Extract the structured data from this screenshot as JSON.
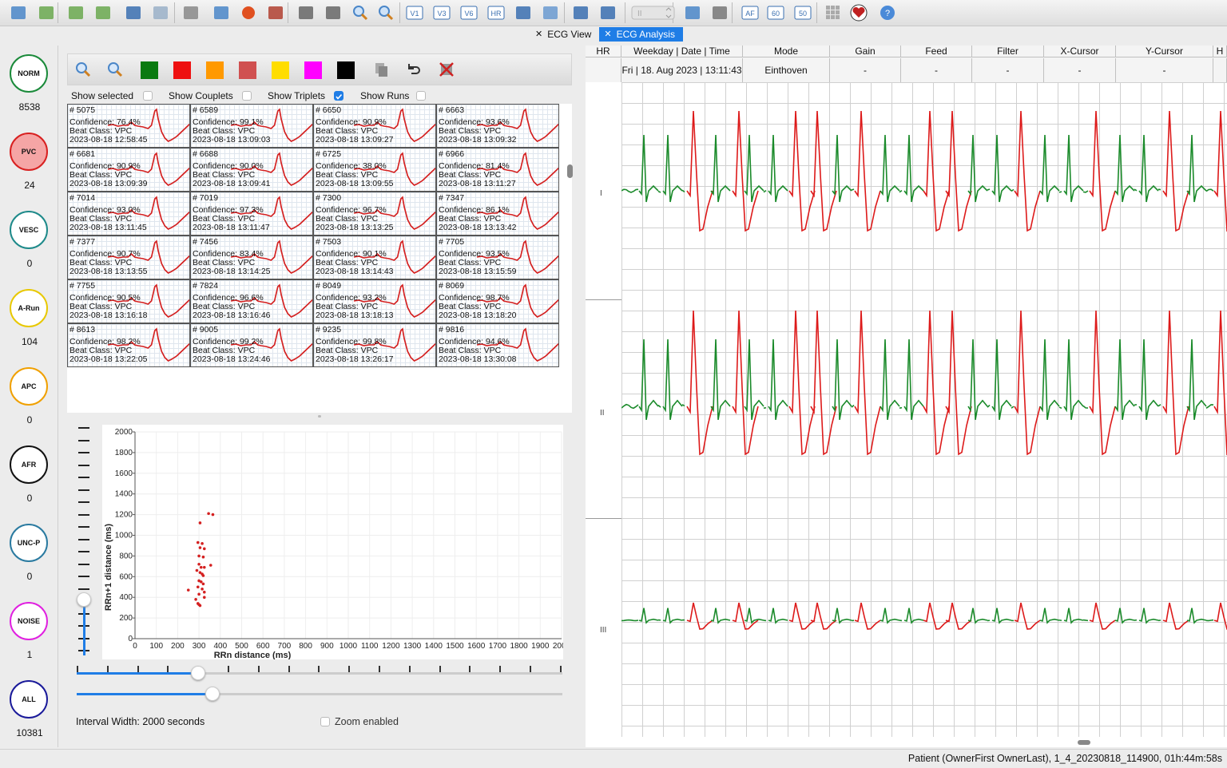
{
  "tabs": [
    {
      "label": "ECG View",
      "active": false
    },
    {
      "label": "ECG Analysis",
      "active": true
    }
  ],
  "toolbar": {
    "icons": [
      "open-file-icon",
      "folder-icon",
      "import-down-icon",
      "export-icon",
      "save-icon",
      "save-as-icon",
      "print-icon",
      "monitor-icon",
      "record-icon",
      "tools-icon",
      "script-icon",
      "script-edit-icon",
      "zoom-out-icon",
      "zoom-in-icon",
      "lead-v1-icon",
      "lead-v3-icon",
      "lead-v6-icon",
      "hr-icon",
      "noise-icon",
      "trend-icon",
      "report-icon",
      "analysis-chart-icon",
      "channel-select-icon",
      "database-icon",
      "lock-icon",
      "af-icon",
      "speed-60-icon",
      "speed-50-icon",
      "grid-icon",
      "heart-icon",
      "help-icon"
    ],
    "labels": {
      "v1": "V1",
      "v3": "V3",
      "v6": "V6",
      "hr": "HR",
      "af": "AF",
      "s60": "60",
      "s50": "50",
      "sel": "II"
    }
  },
  "classes": [
    {
      "name": "NORM",
      "count": "8538",
      "color": "#1a8a3a",
      "fill": "#ffffff"
    },
    {
      "name": "PVC",
      "count": "24",
      "color": "#d82020",
      "fill": "#f5a5a5"
    },
    {
      "name": "VESC",
      "count": "0",
      "color": "#1e8a8a",
      "fill": "#ffffff"
    },
    {
      "name": "A-Run",
      "count": "104",
      "color": "#e8c800",
      "fill": "#ffffff"
    },
    {
      "name": "APC",
      "count": "0",
      "color": "#f0a000",
      "fill": "#ffffff"
    },
    {
      "name": "AFR",
      "count": "0",
      "color": "#111111",
      "fill": "#ffffff"
    },
    {
      "name": "UNC-P",
      "count": "0",
      "color": "#2a7aa0",
      "fill": "#ffffff"
    },
    {
      "name": "NOISE",
      "count": "1",
      "color": "#e020e0",
      "fill": "#ffffff"
    },
    {
      "name": "ALL",
      "count": "10381",
      "color": "#1a1a9a",
      "fill": "#ffffff"
    }
  ],
  "filter_bar": {
    "swatches": [
      "#0a7a10",
      "#ee1010",
      "#ff9900",
      "#d05050",
      "#ffdd00",
      "#ff00ff",
      "#000000"
    ]
  },
  "filters": {
    "selected": "Show selected",
    "couplets": "Show Couplets",
    "triplets": "Show Triplets",
    "runs": "Show Runs",
    "triplets_checked": true
  },
  "beats": [
    {
      "id": "# 5075",
      "conf": "Confidence: 76.4%",
      "cls": "Beat Class: VPC",
      "time": "2023-08-18 12:58:45"
    },
    {
      "id": "# 6589",
      "conf": "Confidence: 99.1%",
      "cls": "Beat Class: VPC",
      "time": "2023-08-18 13:09:03"
    },
    {
      "id": "# 6650",
      "conf": "Confidence: 90.9%",
      "cls": "Beat Class: VPC",
      "time": "2023-08-18 13:09:27"
    },
    {
      "id": "# 6663",
      "conf": "Confidence: 93.6%",
      "cls": "Beat Class: VPC",
      "time": "2023-08-18 13:09:32"
    },
    {
      "id": "# 6681",
      "conf": "Confidence: 90.9%",
      "cls": "Beat Class: VPC",
      "time": "2023-08-18 13:09:39"
    },
    {
      "id": "# 6688",
      "conf": "Confidence: 90.0%",
      "cls": "Beat Class: VPC",
      "time": "2023-08-18 13:09:41"
    },
    {
      "id": "# 6725",
      "conf": "Confidence: 38.0%",
      "cls": "Beat Class: VPC",
      "time": "2023-08-18 13:09:55"
    },
    {
      "id": "# 6966",
      "conf": "Confidence: 81.4%",
      "cls": "Beat Class: VPC",
      "time": "2023-08-18 13:11:27"
    },
    {
      "id": "# 7014",
      "conf": "Confidence: 93.0%",
      "cls": "Beat Class: VPC",
      "time": "2023-08-18 13:11:45"
    },
    {
      "id": "# 7019",
      "conf": "Confidence: 97.3%",
      "cls": "Beat Class: VPC",
      "time": "2023-08-18 13:11:47"
    },
    {
      "id": "# 7300",
      "conf": "Confidence: 96.7%",
      "cls": "Beat Class: VPC",
      "time": "2023-08-18 13:13:25"
    },
    {
      "id": "# 7347",
      "conf": "Confidence: 86.1%",
      "cls": "Beat Class: VPC",
      "time": "2023-08-18 13:13:42"
    },
    {
      "id": "# 7377",
      "conf": "Confidence: 90.7%",
      "cls": "Beat Class: VPC",
      "time": "2023-08-18 13:13:55"
    },
    {
      "id": "# 7456",
      "conf": "Confidence: 83.4%",
      "cls": "Beat Class: VPC",
      "time": "2023-08-18 13:14:25"
    },
    {
      "id": "# 7503",
      "conf": "Confidence: 90.1%",
      "cls": "Beat Class: VPC",
      "time": "2023-08-18 13:14:43"
    },
    {
      "id": "# 7705",
      "conf": "Confidence: 93.5%",
      "cls": "Beat Class: VPC",
      "time": "2023-08-18 13:15:59"
    },
    {
      "id": "# 7755",
      "conf": "Confidence: 90.5%",
      "cls": "Beat Class: VPC",
      "time": "2023-08-18 13:16:18"
    },
    {
      "id": "# 7824",
      "conf": "Confidence: 96.6%",
      "cls": "Beat Class: VPC",
      "time": "2023-08-18 13:16:46"
    },
    {
      "id": "# 8049",
      "conf": "Confidence: 93.2%",
      "cls": "Beat Class: VPC",
      "time": "2023-08-18 13:18:13"
    },
    {
      "id": "# 8069",
      "conf": "Confidence: 98.7%",
      "cls": "Beat Class: VPC",
      "time": "2023-08-18 13:18:20"
    },
    {
      "id": "# 8613",
      "conf": "Confidence: 98.2%",
      "cls": "Beat Class: VPC",
      "time": "2023-08-18 13:22:05"
    },
    {
      "id": "# 9005",
      "conf": "Confidence: 99.2%",
      "cls": "Beat Class: VPC",
      "time": "2023-08-18 13:24:46"
    },
    {
      "id": "# 9235",
      "conf": "Confidence: 99.8%",
      "cls": "Beat Class: VPC",
      "time": "2023-08-18 13:26:17"
    },
    {
      "id": "# 9816",
      "conf": "Confidence: 94.6%",
      "cls": "Beat Class: VPC",
      "time": "2023-08-18 13:30:08"
    }
  ],
  "chart_data": {
    "type": "scatter",
    "xlabel": "RRn distance (ms)",
    "ylabel": "RRn+1 distance (ms)",
    "xlim": [
      0,
      2000
    ],
    "ylim": [
      0,
      2000
    ],
    "xticks": [
      0,
      100,
      200,
      300,
      400,
      500,
      600,
      700,
      800,
      900,
      1000,
      1100,
      1200,
      1300,
      1400,
      1500,
      1600,
      1700,
      1800,
      1900,
      2000
    ],
    "yticks": [
      0,
      200,
      400,
      600,
      800,
      1000,
      1200,
      1400,
      1600,
      1800,
      2000
    ],
    "grid": true,
    "point_color": "#d42020",
    "points": [
      [
        345,
        1210
      ],
      [
        365,
        1200
      ],
      [
        305,
        1120
      ],
      [
        295,
        930
      ],
      [
        315,
        920
      ],
      [
        305,
        880
      ],
      [
        325,
        870
      ],
      [
        300,
        800
      ],
      [
        320,
        790
      ],
      [
        300,
        720
      ],
      [
        355,
        710
      ],
      [
        310,
        690
      ],
      [
        325,
        690
      ],
      [
        290,
        660
      ],
      [
        305,
        640
      ],
      [
        315,
        625
      ],
      [
        320,
        610
      ],
      [
        300,
        560
      ],
      [
        310,
        550
      ],
      [
        320,
        530
      ],
      [
        295,
        500
      ],
      [
        315,
        480
      ],
      [
        250,
        470
      ],
      [
        325,
        450
      ],
      [
        300,
        430
      ],
      [
        325,
        400
      ],
      [
        285,
        380
      ],
      [
        300,
        330
      ],
      [
        305,
        320
      ],
      [
        295,
        340
      ]
    ]
  },
  "sliders": {
    "interval_label": "Interval Width: 2000 seconds",
    "zoom_label": "Zoom enabled",
    "vertical_value": 0.25,
    "top_value": 0.25,
    "bottom_value": 0.28
  },
  "ecg_header": {
    "columns": [
      "HR",
      "Weekday | Date | Time",
      "Mode",
      "Gain",
      "Feed",
      "Filter",
      "X-Cursor",
      "Y-Cursor",
      "H"
    ],
    "values": [
      "",
      "Fri | 18. Aug 2023 | 13:11:43",
      "Einthoven",
      "-",
      "-",
      "-",
      "-",
      "-",
      ""
    ]
  },
  "leads": [
    "I",
    "II",
    "III"
  ],
  "status": "Patient (OwnerFirst OwnerLast), 1_4_20230818_114900, 01h:44m:58s"
}
